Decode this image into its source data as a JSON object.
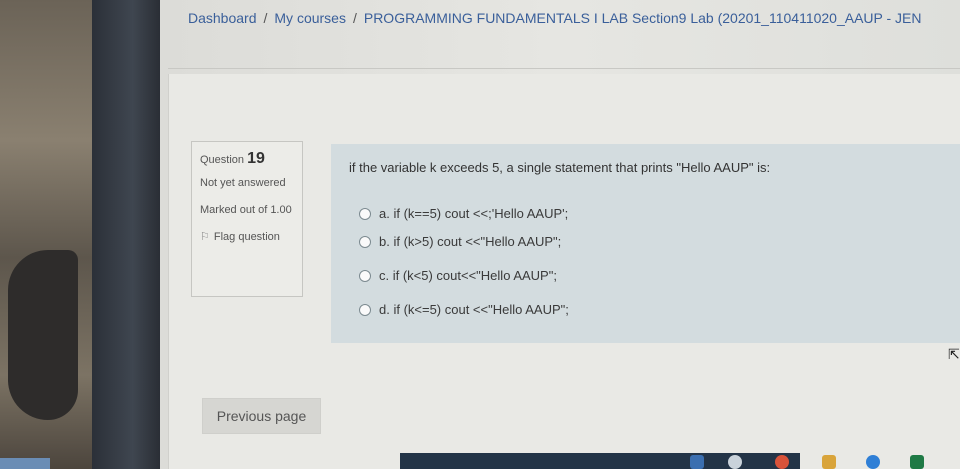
{
  "breadcrumb": {
    "items": [
      {
        "label": "Dashboard"
      },
      {
        "label": "My courses"
      },
      {
        "label": "PROGRAMMING FUNDAMENTALS I LAB Section9 Lab (20201_110411020_AAUP - JEN"
      }
    ],
    "separator": "/"
  },
  "question_info": {
    "question_label": "Question",
    "question_number": "19",
    "status": "Not yet answered",
    "marked": "Marked out of 1.00",
    "flag_label": "Flag question"
  },
  "question": {
    "text": "if the variable k exceeds 5, a single statement that prints \"Hello AAUP\" is:",
    "answers": [
      {
        "label": "a. if (k==5) cout <<;'Hello AAUP';"
      },
      {
        "label": "b. if (k>5) cout <<\"Hello AAUP\";"
      },
      {
        "label": "c. if (k<5) cout<<\"Hello AAUP\";"
      },
      {
        "label": "d. if (k<=5) cout <<\"Hello AAUP\";"
      }
    ]
  },
  "navigation": {
    "previous_label": "Previous page"
  },
  "colors": {
    "link": "#3a5f9a",
    "question_panel": "#d3dcdf",
    "taskbar": "#233447"
  }
}
